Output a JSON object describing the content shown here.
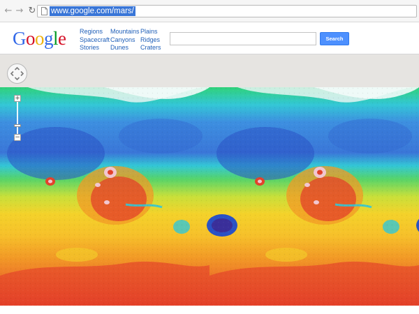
{
  "browser": {
    "back_icon": "arrow-left-icon",
    "forward_icon": "arrow-right-icon",
    "reload_icon": "reload-icon",
    "url": "www.google.com/mars/",
    "url_selected": true
  },
  "header": {
    "logo_letters": [
      {
        "char": "G",
        "color": "#3369e8"
      },
      {
        "char": "o",
        "color": "#d50f25"
      },
      {
        "char": "o",
        "color": "#eeb211"
      },
      {
        "char": "g",
        "color": "#3369e8"
      },
      {
        "char": "l",
        "color": "#009925"
      },
      {
        "char": "e",
        "color": "#d50f25"
      }
    ],
    "nav_columns": [
      [
        "Regions",
        "Spacecraft",
        "Stories"
      ],
      [
        "Mountains",
        "Canyons",
        "Dunes"
      ],
      [
        "Plains",
        "Ridges",
        "Craters"
      ]
    ],
    "search_value": "",
    "search_button_label": "Search",
    "link_color": "#1f5fb8",
    "button_color": "#4d90fe"
  },
  "map": {
    "pan_control_icon": "pan-arrows-icon",
    "zoom_in_label": "+",
    "zoom_out_label": "−",
    "elevation_colors": [
      "#2a52c4",
      "#3d8fe0",
      "#33c7d6",
      "#2fd27a",
      "#b6e23c",
      "#f4d22a",
      "#f29a26",
      "#e3412a",
      "#f2c6d0"
    ]
  }
}
